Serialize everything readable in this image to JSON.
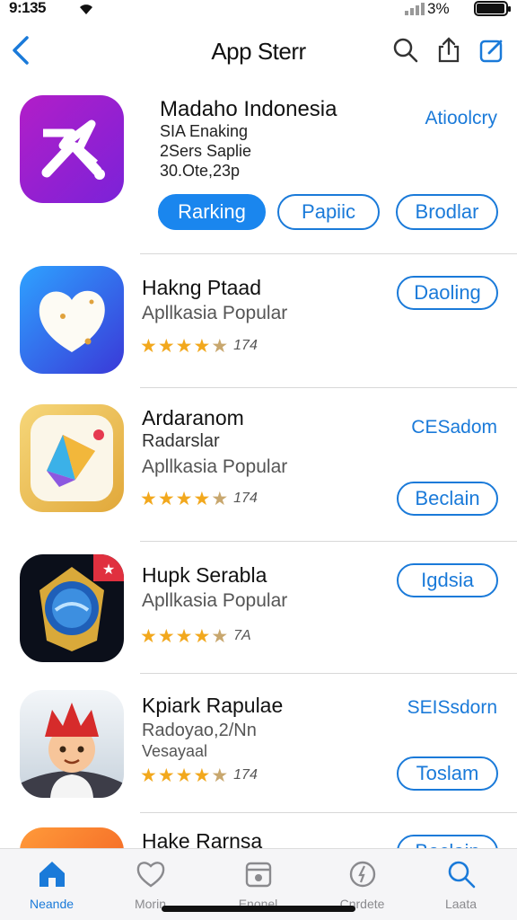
{
  "status_bar": {
    "time": "9:135",
    "battery": "3%",
    "icons": [
      "wifi-icon",
      "signal-icon",
      "battery-icon"
    ]
  },
  "nav": {
    "title": "App Sterr",
    "icons": [
      "back-chevron-icon",
      "search-icon",
      "share-icon",
      "edit-icon"
    ]
  },
  "featured": {
    "name": "Madaho Indonesia",
    "line1": "SIA Enaking",
    "line2": "2Sers Saplie",
    "line3": "30.Ote,23p",
    "link": "Atioolcry",
    "buttons": [
      "Rarking",
      "Papiic",
      "Brodlar"
    ],
    "icon": "purple-app-logo"
  },
  "apps": [
    {
      "name": "Hakng Ptaad",
      "subtitle": "Apllkasia Popular",
      "extra": "",
      "rating": 4.5,
      "rating_count": "174",
      "link": "",
      "button": "Daoling",
      "icon": "heart-app-icon"
    },
    {
      "name": "Ardaranom",
      "subtitle": "Apllkasia Popular",
      "extra": "Radarslar",
      "rating": 4.5,
      "rating_count": "174",
      "link": "CESadom",
      "button": "Beclain",
      "icon": "gold-shape-app-icon"
    },
    {
      "name": "Hupk Serabla",
      "subtitle": "Apllkasia Popular",
      "extra": "",
      "rating": 4.5,
      "rating_count": "7A",
      "link": "",
      "button": "Igdsia",
      "icon": "game-badge-app-icon"
    },
    {
      "name": "Kpiark Rapulae",
      "subtitle": "Radoyao,2/Nn",
      "extra": "Vesayaal",
      "rating": 4.5,
      "rating_count": "174",
      "link": "SEISsdorn",
      "button": "Toslam",
      "icon": "character-app-icon"
    },
    {
      "name": "Hake Rarnsa",
      "subtitle": "",
      "extra": "",
      "rating": null,
      "rating_count": "",
      "link": "",
      "button": "Beclain",
      "icon": "orange-app-icon"
    }
  ],
  "tabs": [
    {
      "label": "Neande",
      "icon": "home-icon",
      "active": true
    },
    {
      "label": "Morin",
      "icon": "heart-icon",
      "active": false
    },
    {
      "label": "Enonel",
      "icon": "calendar-icon",
      "active": false
    },
    {
      "label": "Cnrdete",
      "icon": "compass-icon",
      "active": false
    },
    {
      "label": "Laata",
      "icon": "search-icon",
      "active": false
    }
  ],
  "colors": {
    "accent": "#1a7ad9",
    "button_fill": "#1a86ee",
    "star": "#f2a81d",
    "tab_bar_bg": "#f5f5f7"
  }
}
